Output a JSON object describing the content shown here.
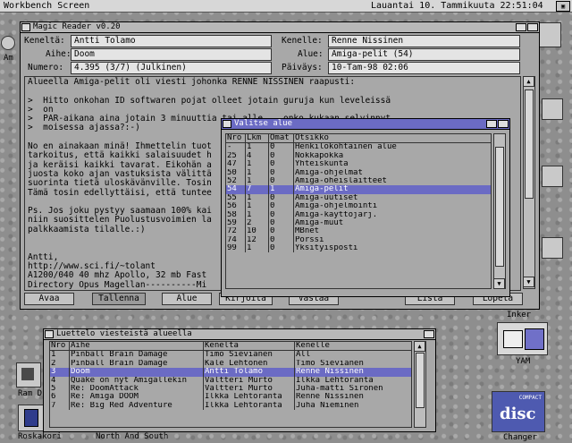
{
  "screen": {
    "title": "Workbench Screen",
    "clock": "Lauantai 10. Tammikuuta 22:51:04"
  },
  "desktop": {
    "labels": {
      "am": "Am",
      "ram": "Ram D",
      "roskakori": "Roskakori",
      "north": "North And South",
      "yam": "YAM",
      "changer": "Changer",
      "inker": "Inker"
    },
    "disc_label": "disc",
    "disc_small": "COMPACT"
  },
  "reader": {
    "title": "Magic Reader v0.20",
    "from_label": "Keneltä:",
    "from_value": "Antti Tolamo",
    "to_label": "Kenelle:",
    "to_value": "Renne Nissinen",
    "subject_label": "Aihe:",
    "subject_value": "Doom",
    "area_label": "Alue:",
    "area_value": "Amiga-pelit (54)",
    "number_label": "Numero:",
    "number_value": "4.395 (3/7) (Julkinen)",
    "date_label": "Päiväys:",
    "date_value": "10-Tam-98 02:06",
    "body": "Alueella Amiga-pelit oli viesti johonka RENNE NISSINEN raapusti:\n\n>  Hitto onkohan ID softwaren pojat olleet jotain guruja kun leveleissä\n>  on\n>  PAR-aikana aina jotain 3 minuuttia tai alle... onko kukaan selvinnyt\n>  moisessa ajassa?:-)\n\nNo en ainakaan minä! Ihmettelin tuot\ntarkoitus, että kaikki salaisuudet h\nja keräisi kaikki tavarat. Eikohän a\njuosta koko ajan vastuksista välittä\nsuorinta tietä uloskävänville. Tosin\nTämä tosin edellyttäisi, että tuntee\n\nPs. Jos joku pystyy saamaan 100% kai\nniin suosittelen Puolustusvoimien la\npalkkaamista tilalle.:)\n\n\nAntti,\nhttp://www.sci.fi/~tolant\nA1200/040 40 mhz Apollo, 32 mb Fast\nDirectory Opus Magellan----------Mi\n<tsb>",
    "buttons": {
      "avaa": "Avaa",
      "tallenna": "Tallenna",
      "alue": "Alue",
      "kirjoita": "Kirjoita",
      "vastaa": "Vastaa",
      "lista": "Lista",
      "lopeta": "Lopeta"
    }
  },
  "areas": {
    "title": "Valitse alue",
    "headers": [
      "Nro",
      "Lkm",
      "Omat",
      "Otsikko"
    ],
    "rows": [
      [
        "-",
        "1",
        "0",
        "Henkilökohtainen alue"
      ],
      [
        "25",
        "4",
        "0",
        "Nokkapokka"
      ],
      [
        "47",
        "1",
        "0",
        "Yhteiskunta"
      ],
      [
        "50",
        "1",
        "0",
        "Amiga-ohjelmat"
      ],
      [
        "52",
        "1",
        "0",
        "Amiga-oheislaitteet"
      ],
      [
        "54",
        "7",
        "1",
        "Amiga-pelit"
      ],
      [
        "55",
        "1",
        "0",
        "Amiga-uutiset"
      ],
      [
        "56",
        "1",
        "0",
        "Amiga-ohjelmointi"
      ],
      [
        "58",
        "1",
        "0",
        "Amiga-käyttöjärj."
      ],
      [
        "59",
        "2",
        "0",
        "Amiga-muut"
      ],
      [
        "72",
        "10",
        "0",
        "MBnet"
      ],
      [
        "74",
        "12",
        "0",
        "Pörssi"
      ],
      [
        "99",
        "1",
        "0",
        "Yksityisposti"
      ]
    ],
    "selected_index": 5
  },
  "messages": {
    "title": "Luettelo viesteistä alueella",
    "headers": [
      "Nro",
      "Aihe",
      "Keneltä",
      "Kenelle"
    ],
    "rows": [
      [
        "1",
        "Pinball Brain Damage",
        "Timo Sieviänen",
        "All"
      ],
      [
        "2",
        "Pinball Brain Damage",
        "Kale Lehtonen",
        "Timo Sieviänen"
      ],
      [
        "3",
        "Doom",
        "Antti Tolamo",
        "Renne Nissinen"
      ],
      [
        "4",
        "Quake on nyt Amigallekin",
        "Valtteri Murto",
        "Ilkka Lehtoranta"
      ],
      [
        "5",
        "Re: DoomAttack",
        "Valtteri Murto",
        "Juha-matti Sironen"
      ],
      [
        "6",
        "Re: Amiga DOOM",
        "Ilkka Lehtoranta",
        "Renne Nissinen"
      ],
      [
        "7",
        "Re: Big Red Adventure",
        "Ilkka Lehtoranta",
        "Juha Nieminen"
      ]
    ],
    "selected_index": 2
  }
}
